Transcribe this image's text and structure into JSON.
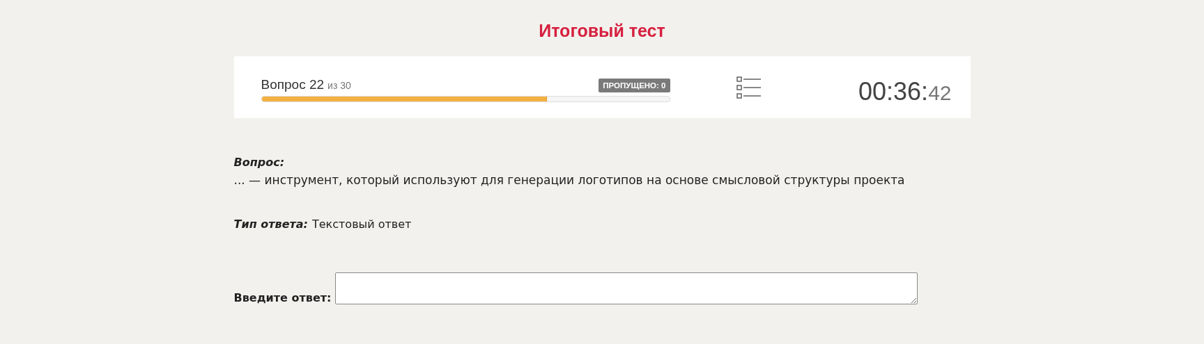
{
  "title": "Итоговый тест",
  "progress": {
    "label": "Вопрос 22",
    "total": "из 30",
    "skipped": "ПРОПУЩЕНО: 0",
    "level": 0.7
  },
  "timer": {
    "main": "00:36:",
    "seconds": "42"
  },
  "question": {
    "label": "Вопрос:",
    "text": "... — инструмент, который используют для генерации логотипов на основе смысловой структуры проекта"
  },
  "answer_type": {
    "label": "Тип ответа:",
    "value": "Текстовый ответ"
  },
  "answer": {
    "label": "Введите ответ:"
  }
}
